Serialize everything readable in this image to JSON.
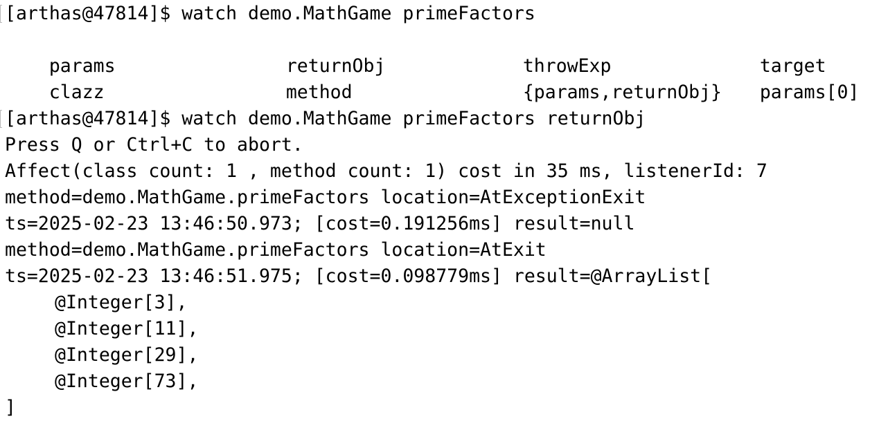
{
  "terminal": {
    "prompt_1": "[arthas@47814]$ watch demo.MathGame primeFactors",
    "completions": {
      "row1": [
        "params",
        "returnObj",
        "throwExp",
        "target"
      ],
      "row2": [
        "clazz",
        "method",
        "{params,returnObj}",
        "params[0]"
      ]
    },
    "prompt_2": "[arthas@47814]$ watch demo.MathGame primeFactors returnObj",
    "abort_hint": "Press Q or Ctrl+C to abort.",
    "affect_line": "Affect(class count: 1 , method count: 1) cost in 35 ms, listenerId: 7",
    "event_1_method": "method=demo.MathGame.primeFactors location=AtExceptionExit",
    "event_1_result": "ts=2025-02-23 13:46:50.973; [cost=0.191256ms] result=null",
    "event_2_method": "method=demo.MathGame.primeFactors location=AtExit",
    "event_2_result": "ts=2025-02-23 13:46:51.975; [cost=0.098779ms] result=@ArrayList[",
    "array_items": [
      "@Integer[3],",
      "@Integer[11],",
      "@Integer[29],",
      "@Integer[73],"
    ],
    "array_close": "]"
  }
}
